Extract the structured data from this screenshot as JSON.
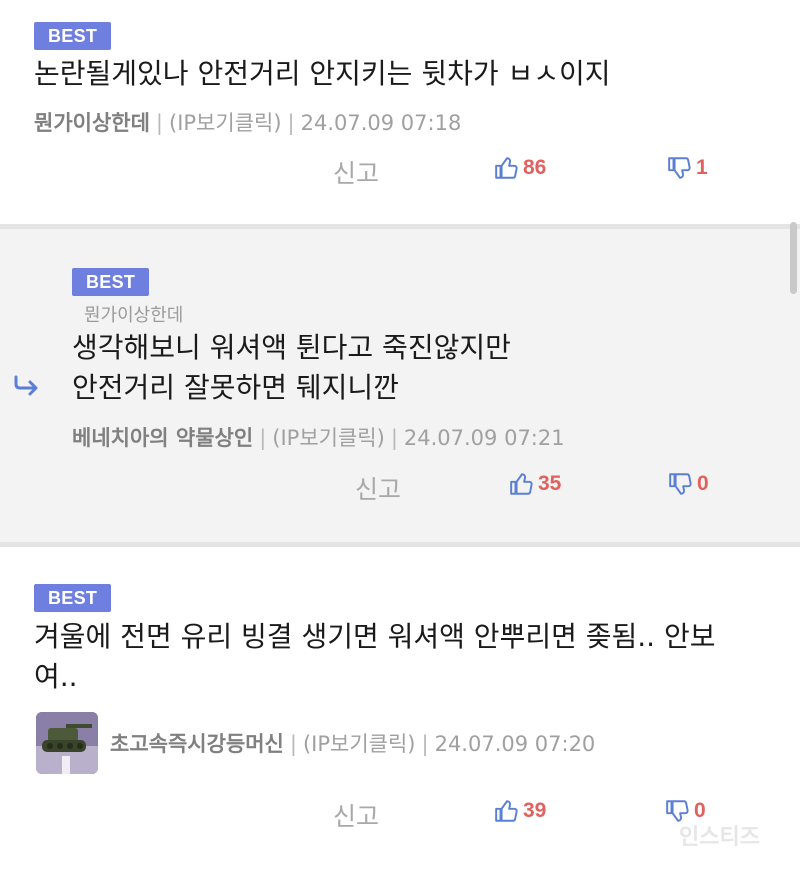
{
  "comments": [
    {
      "badge": "BEST",
      "text_lines": [
        "논란될게있나 안전거리 안지키는 뒷차가 ㅂㅅ이지"
      ],
      "nickname": "뭔가이상한데",
      "ip": "(IP보기클릭)",
      "timestamp": "24.07.09 07:18",
      "report_label": "신고",
      "upvotes": "86",
      "downvotes": "1"
    },
    {
      "badge": "BEST",
      "reply_to": "뭔가이상한데",
      "text_lines": [
        "생각해보니 워셔액 튄다고 죽진않지만",
        "안전거리 잘못하면 뒈지니깐"
      ],
      "nickname": "베네치아의 약물상인",
      "ip": "(IP보기클릭)",
      "timestamp": "24.07.09 07:21",
      "report_label": "신고",
      "upvotes": "35",
      "downvotes": "0"
    },
    {
      "badge": "BEST",
      "text_lines": [
        "겨울에 전면 유리 빙결 생기면 워셔액 안뿌리면 좆됨.. 안보",
        "여.."
      ],
      "nickname": "초고속즉시강등머신",
      "ip": "(IP보기클릭)",
      "timestamp": "24.07.09 07:20",
      "report_label": "신고",
      "upvotes": "39",
      "downvotes": "0"
    }
  ],
  "separator": "|",
  "watermark": "인스티즈",
  "colors": {
    "badge": "#6e7fe0",
    "vote_count": "#e0625f",
    "icon": "#5b7fd6",
    "reply_bg": "#f3f3f3"
  },
  "icons": {
    "up": "thumbs-up-icon",
    "down": "thumbs-down-icon",
    "reply": "reply-arrow-icon"
  }
}
